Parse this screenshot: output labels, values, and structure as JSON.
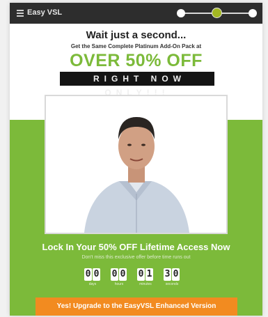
{
  "topbar": {
    "brand": "Easy VSL",
    "steps": 3,
    "active_step": 2
  },
  "headline": "Wait just a second...",
  "subheadline": "Get the Same Complete Platinum Add-On Pack at",
  "offer": "OVER 50% OFF",
  "banner": "RIGHT NOW ONLY!!!",
  "video": {
    "description": "presenter-video"
  },
  "lock_text": "Lock In Your 50% OFF Lifetime Access Now",
  "sub_text": "Don't miss this exclusive offer before time runs out",
  "timer": {
    "days": "00",
    "hours": "00",
    "minutes": "01",
    "seconds": "30",
    "labels": [
      "days",
      "hours",
      "minutes",
      "seconds"
    ]
  },
  "cta": "Yes! Upgrade to the EasyVSL Enhanced Version",
  "colors": {
    "green": "#7cba3a",
    "orange": "#f28b20",
    "dark": "#2d2d2d",
    "active_dot": "#a3b822"
  }
}
